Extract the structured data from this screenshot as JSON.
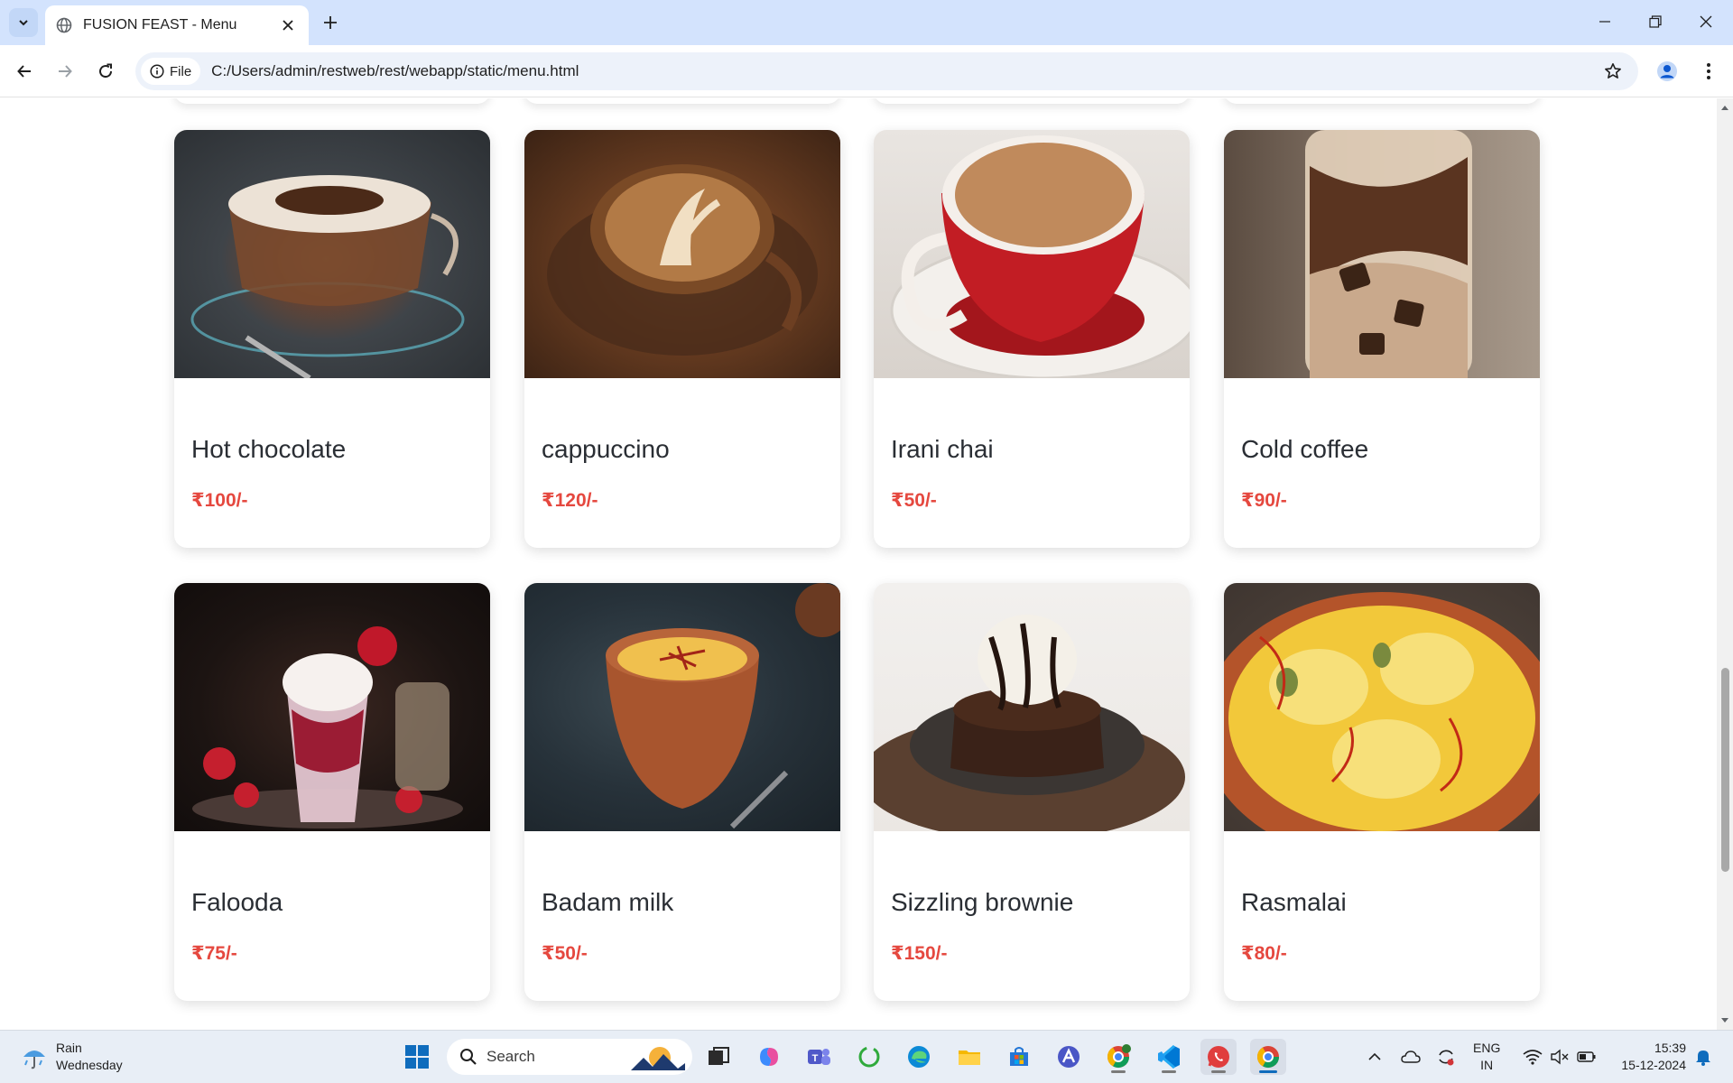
{
  "browser": {
    "tab_title": "FUSION FEAST - Menu",
    "chip_label": "File",
    "url": "C:/Users/admin/restweb/rest/webapp/static/menu.html"
  },
  "menu": {
    "items": [
      {
        "name": "Hot chocolate",
        "price": "₹100/-"
      },
      {
        "name": "cappuccino",
        "price": "₹120/-"
      },
      {
        "name": "Irani chai",
        "price": "₹50/-"
      },
      {
        "name": "Cold coffee",
        "price": "₹90/-"
      },
      {
        "name": "Falooda",
        "price": "₹75/-"
      },
      {
        "name": "Badam milk",
        "price": "₹50/-"
      },
      {
        "name": "Sizzling brownie",
        "price": "₹150/-"
      },
      {
        "name": "Rasmalai",
        "price": "₹80/-"
      }
    ]
  },
  "taskbar": {
    "weather_condition": "Rain",
    "weather_day": "Wednesday",
    "search_placeholder": "Search",
    "lang_line1": "ENG",
    "lang_line2": "IN",
    "time": "15:39",
    "date": "15-12-2024"
  },
  "colors": {
    "price": "#e5483f",
    "tabstrip": "#d3e3fd",
    "taskbar": "#e8eef6"
  }
}
